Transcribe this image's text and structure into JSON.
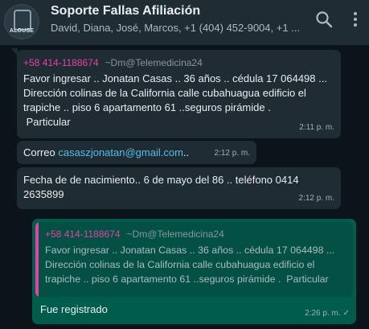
{
  "header": {
    "title": "Soporte Fallas Afiliación",
    "participants": "David, Diana, José, Marcos, +1 (404) 452-9004, +1 ...",
    "avatar_text": "ALOUSE",
    "search_icon": "search-icon",
    "menu_icon": "more-vertical-icon"
  },
  "messages": [
    {
      "sender_number": "+58 414-1188674",
      "sender_alias": "~Dm@Telemedicina24",
      "text": "Favor ingresar .. Jonatan Casas .. 36 años .. cédula 17 064498 ...\nDirección colinas de la California calle cubahuagua edificio el trapiche .. piso 6 apartamento 61 ..seguros pirámide .\n Particular",
      "time": "2:11 p. m."
    },
    {
      "prefix": "Correo ",
      "link": "casaszjonatan@gmail.com",
      "suffix": "..",
      "time": "2:12 p. m."
    },
    {
      "text": "Fecha de de nacimiento.. 6 de mayo del 86 .. teléfono 0414\n2635899",
      "time": "2:12 p. m."
    },
    {
      "quoted_sender_number": "+58 414-1188674",
      "quoted_sender_alias": "~Dm@Telemedicina24",
      "quoted_text": "Favor ingresar .. Jonatan Casas .. 36 años .. cédula 17 064498 ...\nDirección colinas de la California calle cubahuagua edificio el\ntrapiche .. piso 6 apartamento 61 ..seguros pirámide .  Particular",
      "text": "Fue registrado",
      "time": "2:26 p. m.",
      "status": "✓"
    }
  ],
  "colors": {
    "background": "#0b141a",
    "header": "#1f2c34",
    "incoming_bubble": "#1f2c34",
    "outgoing_bubble": "#005c4b",
    "sender_name": "#e542a3",
    "link": "#53bdeb"
  }
}
